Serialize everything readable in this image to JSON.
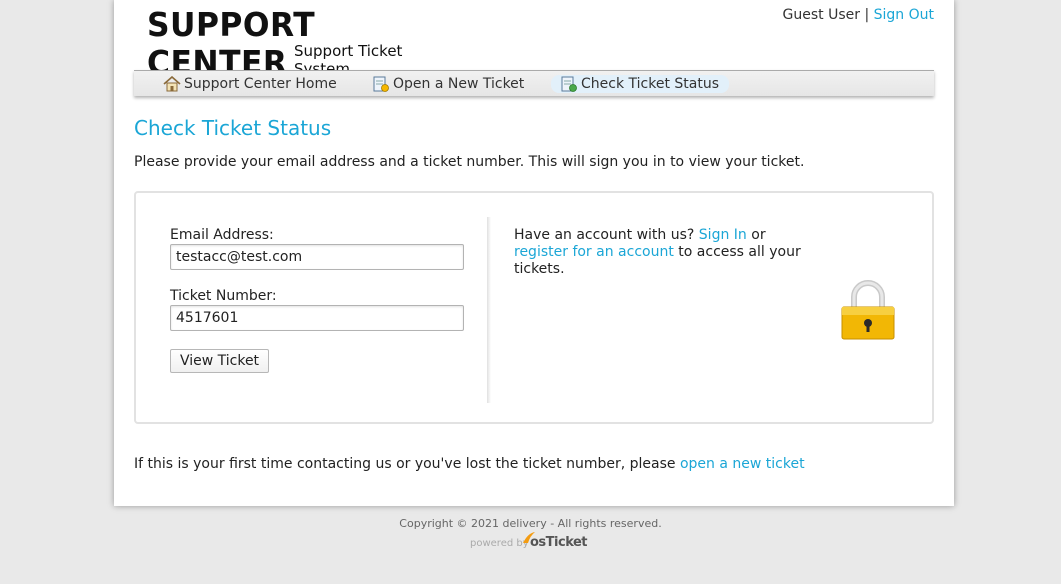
{
  "header": {
    "logo_title": "SUPPORT CENTER",
    "logo_subtitle": "Support Ticket System",
    "user_label": "Guest User",
    "separator": "|",
    "signout_link": "Sign Out"
  },
  "nav": {
    "items": [
      {
        "label": "Support Center Home",
        "icon": "home-icon",
        "active": false
      },
      {
        "label": "Open a New Ticket",
        "icon": "new-ticket-icon",
        "active": false
      },
      {
        "label": "Check Ticket Status",
        "icon": "ticket-status-icon",
        "active": true
      }
    ]
  },
  "main": {
    "title": "Check Ticket Status",
    "intro": "Please provide your email address and a ticket number. This will sign you in to view your ticket."
  },
  "form": {
    "email_label": "Email Address:",
    "email_value": "testacc@test.com",
    "ticket_label": "Ticket Number:",
    "ticket_value": "4517601",
    "submit_label": "View Ticket"
  },
  "side": {
    "text_1": "Have an account with us?",
    "signin_link": "Sign In",
    "text_2": "or",
    "register_link": "register for an account",
    "text_3": "to access all your tickets."
  },
  "bottom": {
    "text": "If this is your first time contacting us or you've lost the ticket number, please",
    "link": "open a new ticket"
  },
  "footer": {
    "copyright": "Copyright © 2021 delivery - All rights reserved.",
    "powered_text": "powered by",
    "powered_brand": "osTicket"
  },
  "colors": {
    "accent": "#1ba6d6",
    "lock_body": "#f2b705"
  }
}
